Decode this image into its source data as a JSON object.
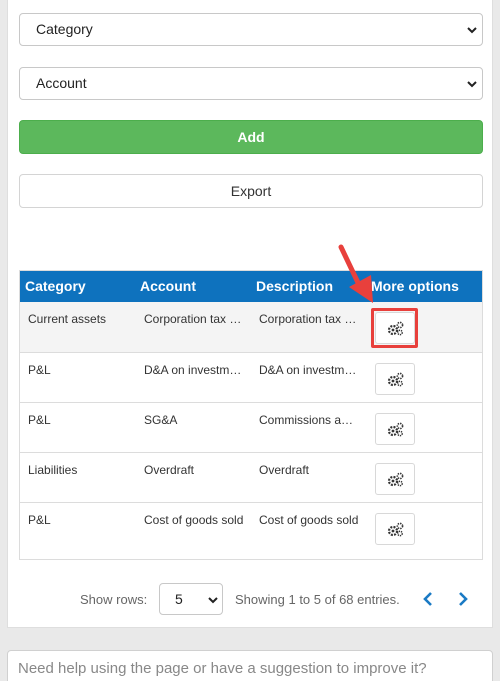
{
  "form": {
    "category_select": "Category",
    "account_select": "Account",
    "add_label": "Add",
    "export_label": "Export"
  },
  "table": {
    "headers": [
      "Category",
      "Account",
      "Description",
      "More options"
    ],
    "rows": [
      [
        "Current assets",
        "Corporation tax …",
        "Corporation tax …"
      ],
      [
        "P&L",
        "D&A on investm…",
        "D&A on investm…"
      ],
      [
        "P&L",
        "SG&A",
        "Commissions a…"
      ],
      [
        "Liabilities",
        "Overdraft",
        "Overdraft"
      ],
      [
        "P&L",
        "Cost of goods sold",
        "Cost of goods sold"
      ]
    ]
  },
  "footer": {
    "show_rows_label": "Show rows:",
    "rows_value": "5",
    "entries_text": "Showing 1 to 5 of 68 entries."
  },
  "help": {
    "placeholder": "Need help using the page or have a suggestion to improve it?"
  },
  "colors": {
    "header_bg": "#0e72be",
    "add_green": "#5cb85c",
    "highlight_red": "#e8403c",
    "pager_blue": "#1a7ac4"
  },
  "icons": [
    "chevron-down-icon",
    "gear-icon",
    "chevron-left-icon",
    "chevron-right-icon",
    "arrow-pointer-icon"
  ]
}
